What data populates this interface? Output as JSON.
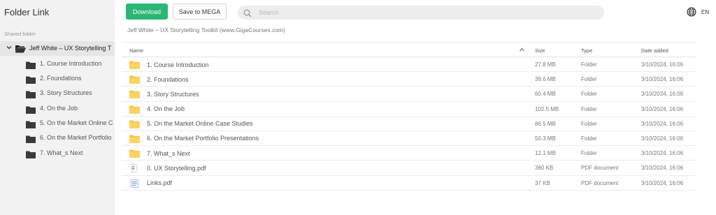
{
  "sidebar": {
    "title": "Folder Link",
    "section_label": "Shared folder",
    "root": {
      "label": "Jeff White – UX Storytelling T",
      "icon": "folder-open-icon"
    },
    "items": [
      {
        "label": "1. Course Introduction",
        "icon": "folder-icon"
      },
      {
        "label": "2. Foundations",
        "icon": "folder-icon"
      },
      {
        "label": "3. Story Structures",
        "icon": "folder-icon"
      },
      {
        "label": "4. On the Job",
        "icon": "folder-icon"
      },
      {
        "label": "5. On the Market Online C",
        "icon": "folder-icon"
      },
      {
        "label": "6. On the Market Portfolio",
        "icon": "folder-icon"
      },
      {
        "label": "7. What_s Next",
        "icon": "folder-icon"
      }
    ]
  },
  "toolbar": {
    "download_label": "Download",
    "save_label": "Save to MEGA",
    "search_placeholder": "Search",
    "language": "EN"
  },
  "breadcrumb": "Jeff White – UX Storytelling Toolkit (www.GigaCourses.com)",
  "table": {
    "columns": {
      "name": "Name",
      "size": "Size",
      "type": "Type",
      "date": "Date added"
    },
    "rows": [
      {
        "name": "1. Course Introduction",
        "size": "27.8 MB",
        "type": "Folder",
        "date": "3/10/2024, 16:06",
        "icon": "folder-icon"
      },
      {
        "name": "2. Foundations",
        "size": "39.6 MB",
        "type": "Folder",
        "date": "3/10/2024, 16:06",
        "icon": "folder-icon"
      },
      {
        "name": "3. Story Structures",
        "size": "60.4 MB",
        "type": "Folder",
        "date": "3/10/2024, 16:06",
        "icon": "folder-icon"
      },
      {
        "name": "4. On the Job",
        "size": "102.5 MB",
        "type": "Folder",
        "date": "3/10/2024, 16:06",
        "icon": "folder-icon"
      },
      {
        "name": "5. On the Market Online Case Studies",
        "size": "86.5 MB",
        "type": "Folder",
        "date": "3/10/2024, 16:06",
        "icon": "folder-icon"
      },
      {
        "name": "6. On the Market Portfolio Presentations",
        "size": "50.3 MB",
        "type": "Folder",
        "date": "3/10/2024, 16:06",
        "icon": "folder-icon"
      },
      {
        "name": "7. What_s Next",
        "size": "12.1 MB",
        "type": "Folder",
        "date": "3/10/2024, 16:06",
        "icon": "folder-icon"
      },
      {
        "name": "0. UX Storytelling.pdf",
        "size": "360 KB",
        "type": "PDF document",
        "date": "3/10/2024, 16:06",
        "icon": "pdf-file-icon"
      },
      {
        "name": "Links.pdf",
        "size": "37 KB",
        "type": "PDF document",
        "date": "3/10/2024, 16:06",
        "icon": "document-file-icon"
      }
    ]
  },
  "colors": {
    "accent": "#2bb673",
    "folder_yellow": "#f8c542",
    "sidebar_bg": "#f2f2f2",
    "sidebar_folder": "#3a3a3a"
  }
}
